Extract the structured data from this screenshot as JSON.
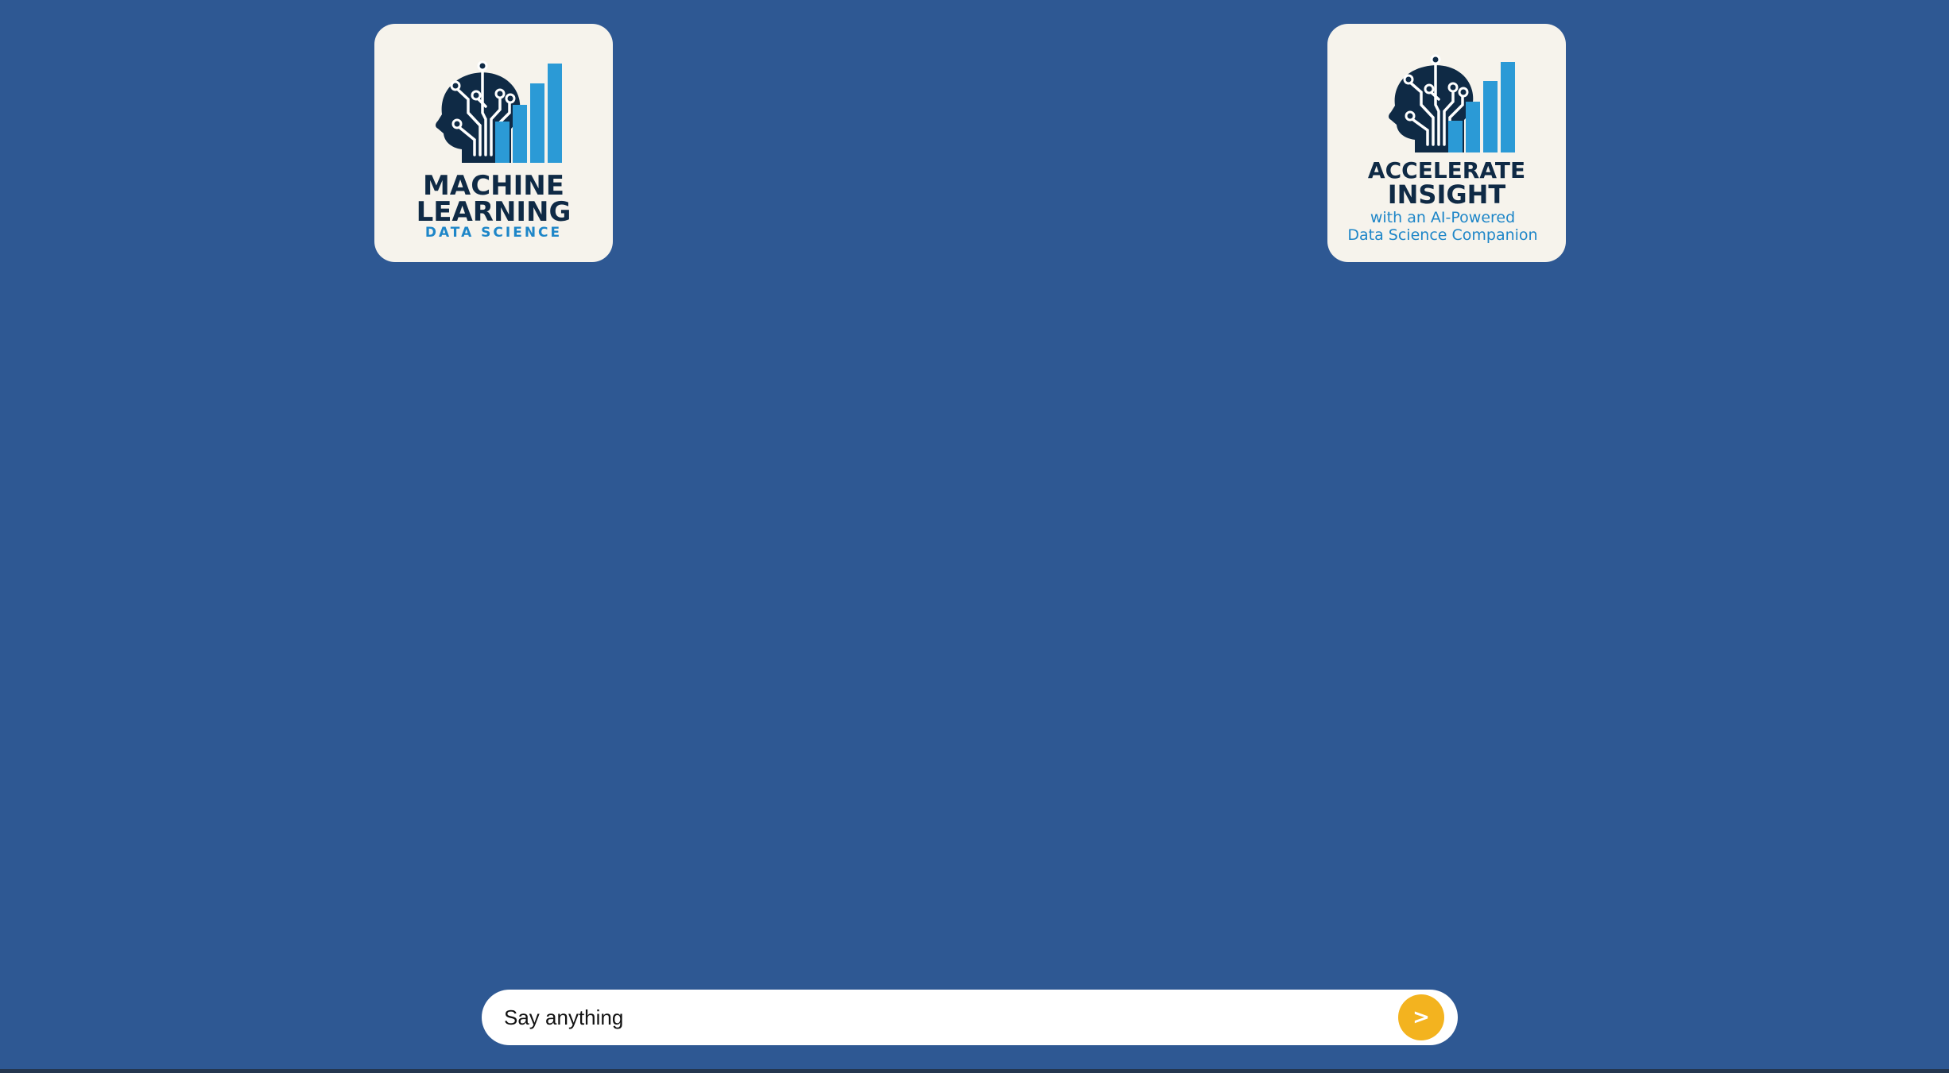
{
  "logos": {
    "left": {
      "line1": "MACHINE",
      "line2": "LEARNING",
      "line3": "DATA SCIENCE"
    },
    "right": {
      "line1": "ACCELERATE",
      "line2": "INSIGHT",
      "line3": "with an AI-Powered",
      "line4": "Data Science Companion"
    }
  },
  "chat": {
    "placeholder": "Say anything",
    "send_label": ">"
  },
  "colors": {
    "background": "#2e5893",
    "card": "#f6f3ec",
    "navy": "#0f2a45",
    "bar_blue": "#2b9ad6",
    "send_button": "#f3b31f"
  },
  "icons": {
    "logo_symbol": "head-with-circuits-and-bar-chart-icon",
    "send": "send-arrow-icon"
  }
}
